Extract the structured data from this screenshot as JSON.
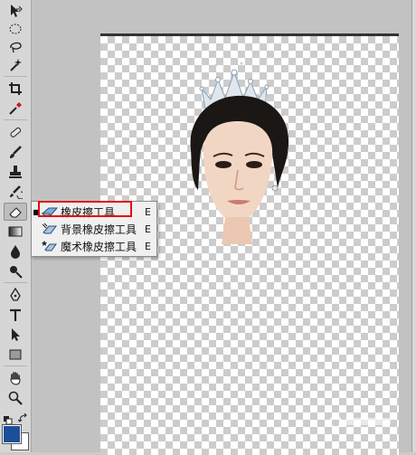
{
  "tools": [
    {
      "name": "move-tool-icon"
    },
    {
      "name": "marquee-tool-icon"
    },
    {
      "name": "lasso-tool-icon"
    },
    {
      "name": "magic-wand-tool-icon"
    },
    {
      "name": "crop-tool-icon"
    },
    {
      "name": "eyedropper-tool-icon"
    },
    {
      "name": "healing-brush-tool-icon"
    },
    {
      "name": "brush-tool-icon"
    },
    {
      "name": "clone-stamp-tool-icon"
    },
    {
      "name": "history-brush-tool-icon"
    },
    {
      "name": "eraser-tool-icon"
    },
    {
      "name": "gradient-tool-icon"
    },
    {
      "name": "blur-tool-icon"
    },
    {
      "name": "dodge-tool-icon"
    },
    {
      "name": "pen-tool-icon"
    },
    {
      "name": "type-tool-icon"
    },
    {
      "name": "path-selection-tool-icon"
    },
    {
      "name": "shape-tool-icon"
    },
    {
      "name": "hand-tool-icon"
    },
    {
      "name": "zoom-tool-icon"
    }
  ],
  "flyout": {
    "items": [
      {
        "label": "橡皮擦工具",
        "shortcut": "E",
        "selected": true
      },
      {
        "label": "背景橡皮擦工具",
        "shortcut": "E",
        "selected": false
      },
      {
        "label": "魔术橡皮擦工具",
        "shortcut": "E",
        "selected": false
      }
    ]
  },
  "colors": {
    "foreground": "#1c4f9a",
    "background": "#ffffff",
    "highlight": "#e01010"
  }
}
